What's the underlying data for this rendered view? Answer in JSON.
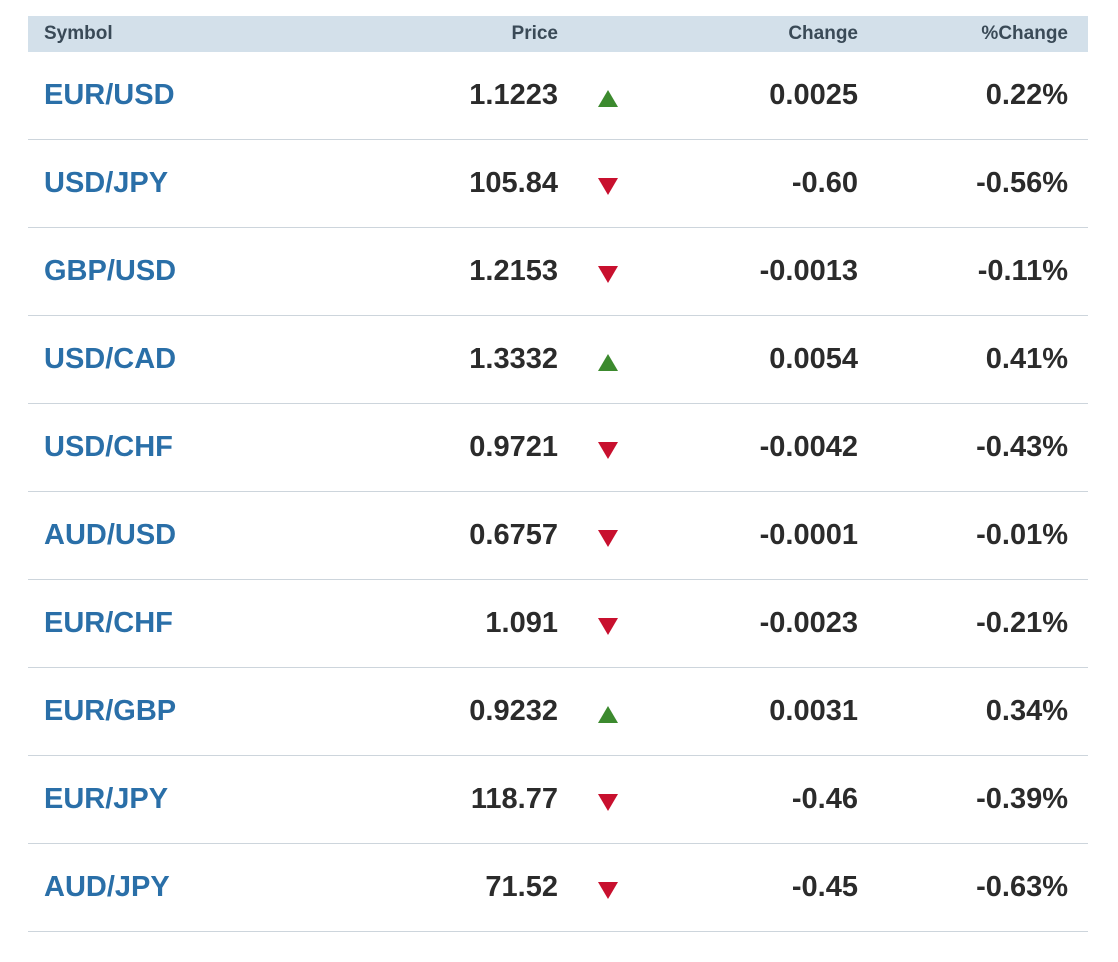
{
  "headers": {
    "symbol": "Symbol",
    "price": "Price",
    "change": "Change",
    "pct_change": "%Change"
  },
  "colors": {
    "up": "#3c8a2e",
    "down": "#c8102e",
    "symbol_link": "#2a6fa8",
    "header_bg": "#d3e0ea"
  },
  "rows": [
    {
      "symbol": "EUR/USD",
      "price": "1.1223",
      "direction": "up",
      "direction_icon": "arrow-up-icon",
      "change": "0.0025",
      "pct_change": "0.22%"
    },
    {
      "symbol": "USD/JPY",
      "price": "105.84",
      "direction": "down",
      "direction_icon": "arrow-down-icon",
      "change": "-0.60",
      "pct_change": "-0.56%"
    },
    {
      "symbol": "GBP/USD",
      "price": "1.2153",
      "direction": "down",
      "direction_icon": "arrow-down-icon",
      "change": "-0.0013",
      "pct_change": "-0.11%"
    },
    {
      "symbol": "USD/CAD",
      "price": "1.3332",
      "direction": "up",
      "direction_icon": "arrow-up-icon",
      "change": "0.0054",
      "pct_change": "0.41%"
    },
    {
      "symbol": "USD/CHF",
      "price": "0.9721",
      "direction": "down",
      "direction_icon": "arrow-down-icon",
      "change": "-0.0042",
      "pct_change": "-0.43%"
    },
    {
      "symbol": "AUD/USD",
      "price": "0.6757",
      "direction": "down",
      "direction_icon": "arrow-down-icon",
      "change": "-0.0001",
      "pct_change": "-0.01%"
    },
    {
      "symbol": "EUR/CHF",
      "price": "1.091",
      "direction": "down",
      "direction_icon": "arrow-down-icon",
      "change": "-0.0023",
      "pct_change": "-0.21%"
    },
    {
      "symbol": "EUR/GBP",
      "price": "0.9232",
      "direction": "up",
      "direction_icon": "arrow-up-icon",
      "change": "0.0031",
      "pct_change": "0.34%"
    },
    {
      "symbol": "EUR/JPY",
      "price": "118.77",
      "direction": "down",
      "direction_icon": "arrow-down-icon",
      "change": "-0.46",
      "pct_change": "-0.39%"
    },
    {
      "symbol": "AUD/JPY",
      "price": "71.52",
      "direction": "down",
      "direction_icon": "arrow-down-icon",
      "change": "-0.45",
      "pct_change": "-0.63%"
    }
  ]
}
